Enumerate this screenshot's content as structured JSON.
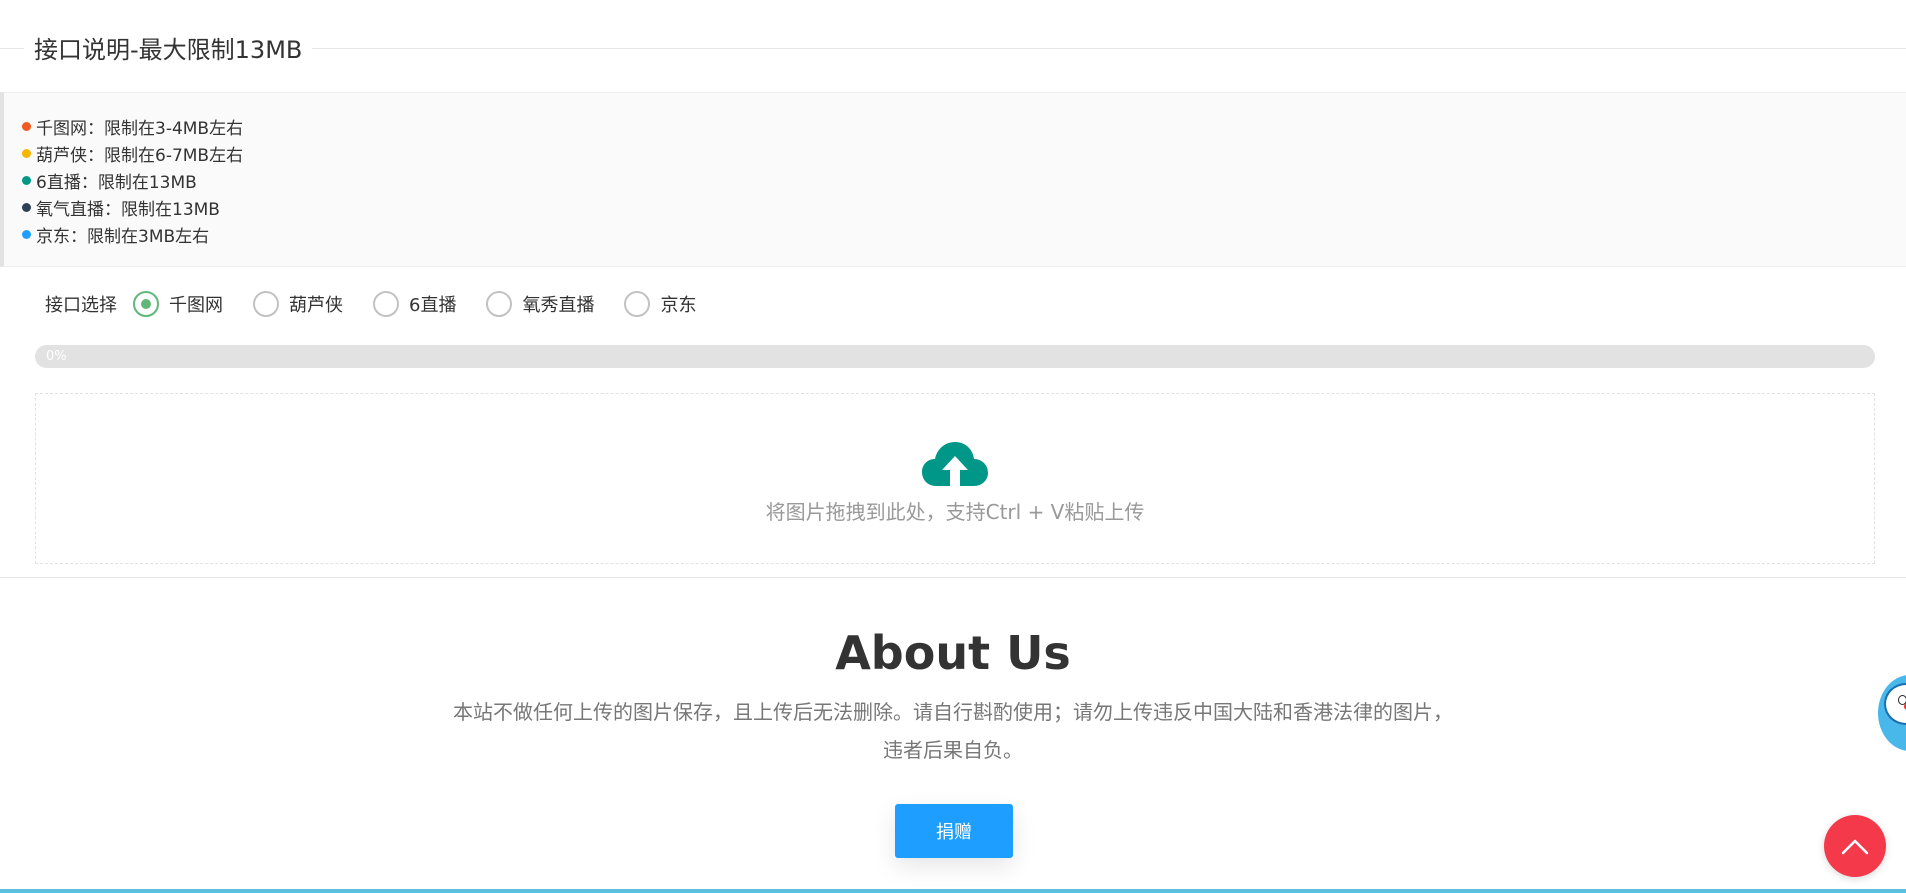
{
  "section": {
    "title": "接口说明-最大限制13MB"
  },
  "limits": [
    {
      "text": "千图网：限制在3-4MB左右",
      "color": "#f15a22"
    },
    {
      "text": "葫芦侠：限制在6-7MB左右",
      "color": "#f7b500"
    },
    {
      "text": "6直播：限制在13MB",
      "color": "#009688"
    },
    {
      "text": "氧气直播：限制在13MB",
      "color": "#2f4056"
    },
    {
      "text": "京东：限制在3MB左右",
      "color": "#1e9fff"
    }
  ],
  "api_select": {
    "label": "接口选择",
    "options": [
      {
        "label": "千图网",
        "checked": true
      },
      {
        "label": "葫芦侠",
        "checked": false
      },
      {
        "label": "6直播",
        "checked": false
      },
      {
        "label": "氧秀直播",
        "checked": false
      },
      {
        "label": "京东",
        "checked": false
      }
    ]
  },
  "progress": {
    "value": 0,
    "text": "0%"
  },
  "upload": {
    "hint": "将图片拖拽到此处，支持Ctrl + V粘贴上传",
    "icon": "cloud-upload-icon",
    "icon_color": "#009688"
  },
  "about": {
    "title": "About Us",
    "text": "本站不做任何上传的图片保存，且上传后无法删除。请自行斟酌使用；请勿上传违反中国大陆和香港法律的图片，违者后果自负。",
    "donate_label": "捐赠"
  },
  "widgets": {
    "back_top_icon": "chevron-up-icon",
    "back_top_color": "#f4394a",
    "mascot_icon": "doraemon-mascot-icon"
  },
  "colors": {
    "accent_green": "#5fb878",
    "accent_blue": "#1e9fff"
  }
}
